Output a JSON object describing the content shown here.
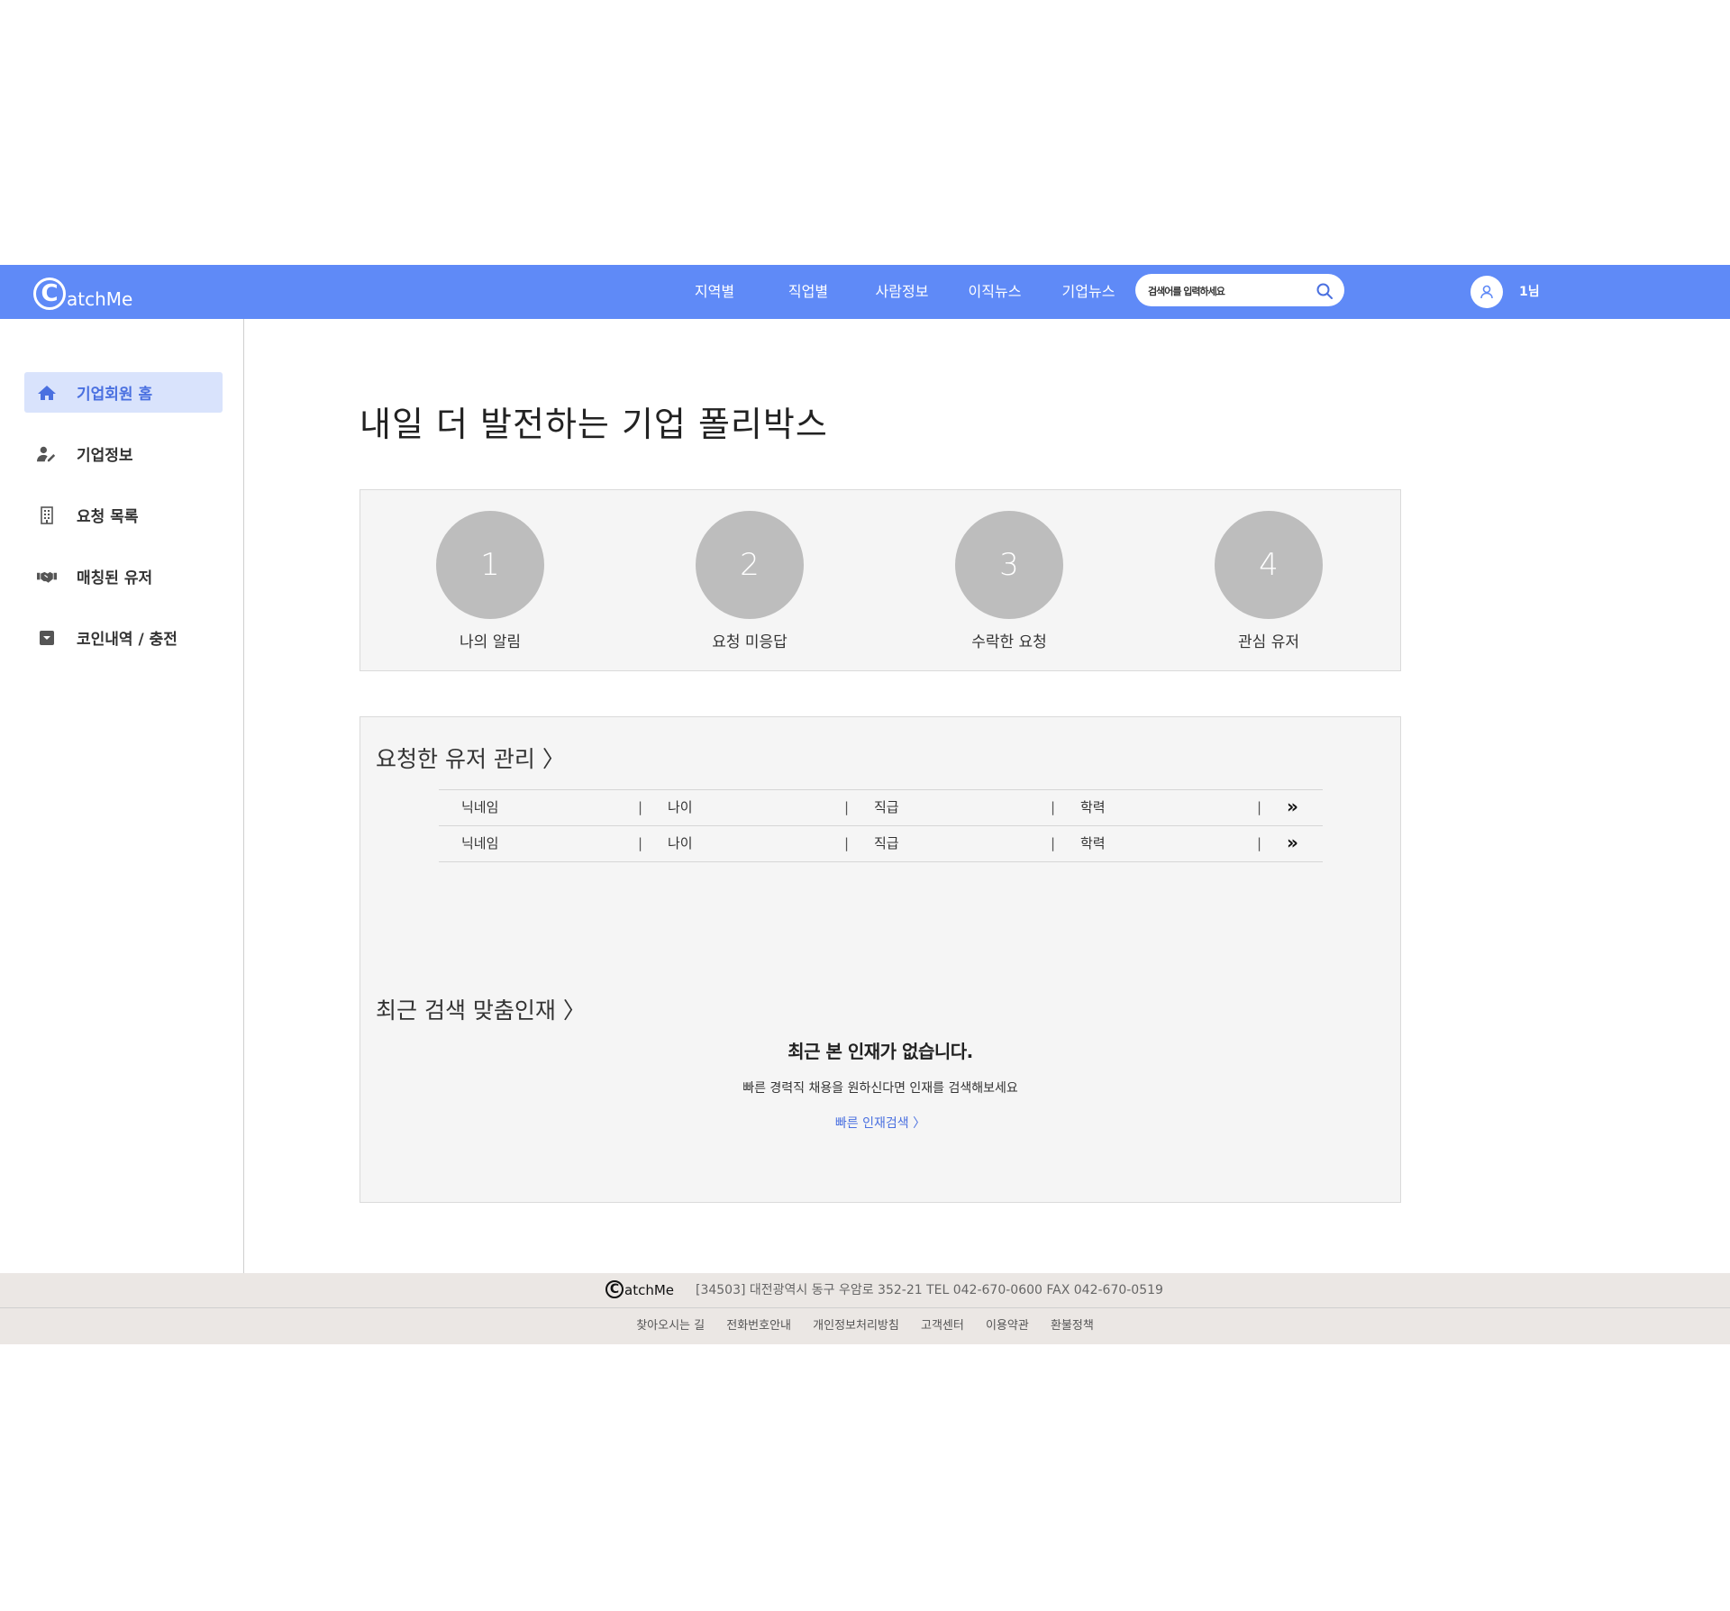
{
  "header": {
    "logo_letter": "C",
    "logo_text": "atchMe",
    "nav": [
      "지역별",
      "직업별",
      "사람정보",
      "이직뉴스",
      "기업뉴스"
    ],
    "search_placeholder": "검색어를 입력하세요",
    "user_name": "1님",
    "brand_color": "#5f8af7"
  },
  "sidebar": {
    "items": [
      {
        "label": "기업회원 홈",
        "icon": "home-icon",
        "active": true
      },
      {
        "label": "기업정보",
        "icon": "user-edit-icon",
        "active": false
      },
      {
        "label": "요청 목록",
        "icon": "building-icon",
        "active": false
      },
      {
        "label": "매칭된 유저",
        "icon": "handshake-icon",
        "active": false
      },
      {
        "label": "코인내역 / 충전",
        "icon": "dropdown-box-icon",
        "active": false
      }
    ]
  },
  "main": {
    "title": "내일 더 발전하는 기업 폴리박스",
    "stats": [
      {
        "value": "1",
        "label": "나의 알림"
      },
      {
        "value": "2",
        "label": "요청 미응답"
      },
      {
        "value": "3",
        "label": "수락한 요청"
      },
      {
        "value": "4",
        "label": "관심 유저"
      }
    ],
    "requested_section": {
      "title": "요청한 유저 관리 〉",
      "rows": [
        {
          "nickname": "닉네임",
          "age": "나이",
          "position": "직급",
          "education": "학력",
          "more": "»"
        },
        {
          "nickname": "닉네임",
          "age": "나이",
          "position": "직급",
          "education": "학력",
          "more": "»"
        }
      ]
    },
    "recent_section": {
      "title": "최근 검색 맞춤인재 〉",
      "empty_title": "최근 본 인재가 없습니다.",
      "empty_desc": "빠른 경력직 채용을 원하신다면 인재를 검색해보세요",
      "link": "빠른 인재검색 〉"
    }
  },
  "footer": {
    "logo_letter": "C",
    "logo_text": "atchMe",
    "address": "[34503] 대전광역시 동구 우암로 352-21 TEL 042-670-0600 FAX 042-670-0519",
    "links": [
      "찾아오시는 길",
      "전화번호안내",
      "개인정보처리방침",
      "고객센터",
      "이용약관",
      "환불정책"
    ]
  }
}
